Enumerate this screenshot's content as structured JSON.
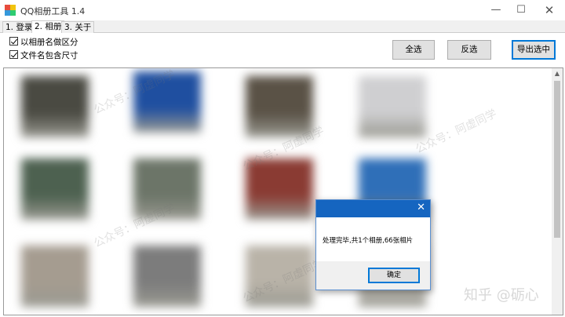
{
  "window": {
    "title": "QQ相册工具 1.4",
    "minimize": "—",
    "maximize": "☐",
    "close": "✕"
  },
  "tabs": [
    {
      "label": "1. 登录",
      "active": false
    },
    {
      "label": "2. 相册",
      "active": true
    },
    {
      "label": "3. 关于",
      "active": false
    }
  ],
  "options": {
    "distinguish_by_album": "以相册名做区分",
    "include_size_in_filename": "文件名包含尺寸"
  },
  "buttons": {
    "select_all": "全选",
    "invert": "反选",
    "export_selected": "导出选中"
  },
  "dialog": {
    "message": "处理完毕,共1个相册,66张相片",
    "ok": "确定",
    "close": "✕"
  },
  "watermark": {
    "text": "公众号：阿虚同学",
    "attribution": "知乎 @砺心"
  },
  "thumb_colors": [
    "#4a4a42",
    "#1f4fa0",
    "#5a5246",
    "#cfcfd1",
    "#4d6150",
    "#6c7568",
    "#8a3b33",
    "#2f6fb8",
    "#a59c90",
    "#7c7c7c",
    "#b9b3a8",
    "#c8c4bd"
  ]
}
